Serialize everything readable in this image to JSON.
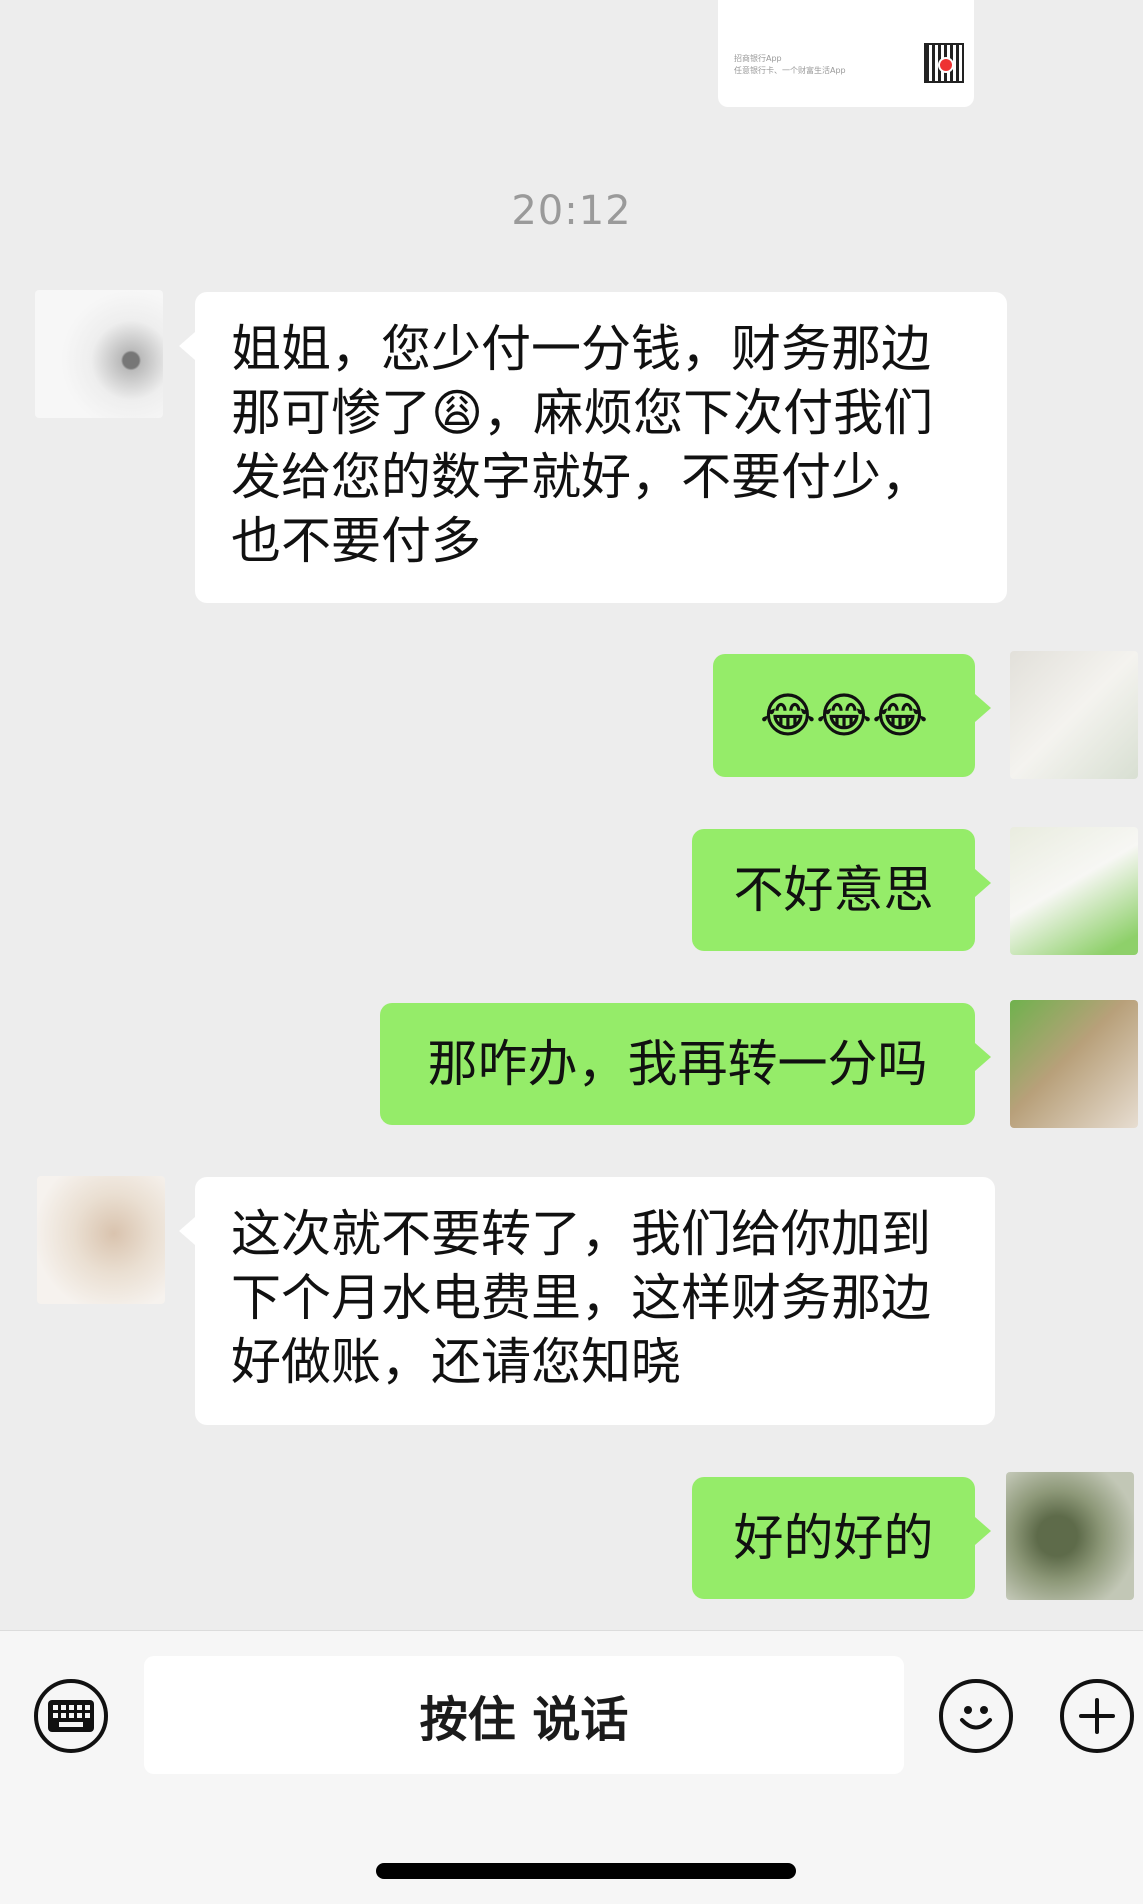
{
  "share_card": {
    "app_name": "招商银行App",
    "app_slogan": "任意银行卡、一个财富生活App"
  },
  "timestamp": "20:12",
  "messages": [
    {
      "side": "in",
      "text": "姐姐，您少付一分钱，财务那边那可惨了😩，麻烦您下次付我们发给您的数字就好，不要付少，也不要付多"
    },
    {
      "side": "out",
      "text": "😂😂😂"
    },
    {
      "side": "out",
      "text": "不好意思"
    },
    {
      "side": "out",
      "text": "那咋办，我再转一分吗"
    },
    {
      "side": "in",
      "text": "这次就不要转了，我们给你加到下个月水电费里，这样财务那边好做账，还请您知晓"
    },
    {
      "side": "out",
      "text": "好的好的"
    }
  ],
  "input_bar": {
    "hold_to_talk_label": "按住 说话",
    "keyboard_icon": "keyboard-icon",
    "emoji_icon": "emoji-icon",
    "plus_icon": "plus-icon"
  },
  "colors": {
    "background": "#ededed",
    "incoming_bubble": "#ffffff",
    "outgoing_bubble": "#95ec69"
  }
}
